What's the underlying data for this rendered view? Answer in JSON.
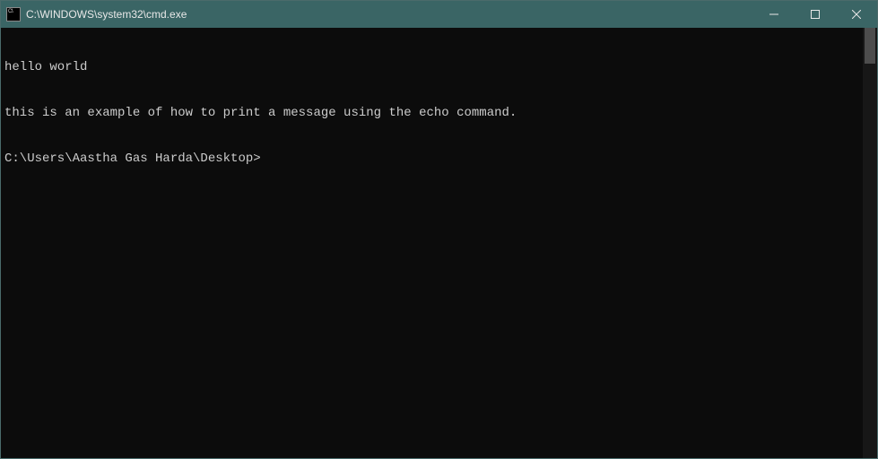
{
  "window": {
    "title": "C:\\WINDOWS\\system32\\cmd.exe"
  },
  "terminal": {
    "lines": [
      "hello world",
      "this is an example of how to print a message using the echo command."
    ],
    "prompt": "C:\\Users\\Aastha Gas Harda\\Desktop>"
  }
}
